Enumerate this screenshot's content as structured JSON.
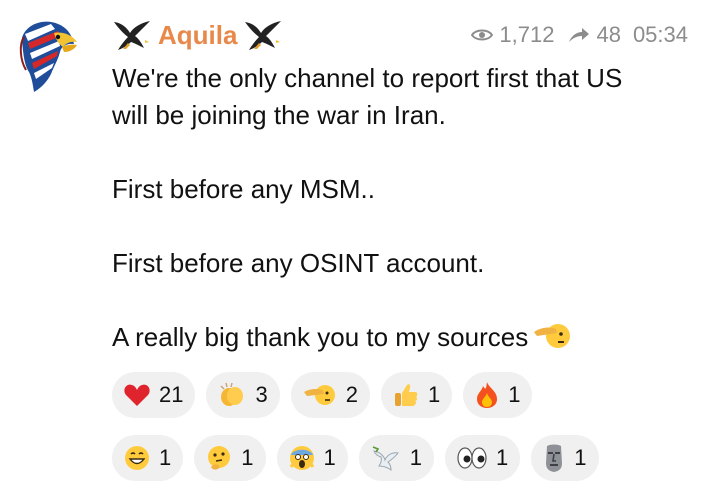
{
  "channel": {
    "name": "Aquila",
    "icon_left": "eagle-icon",
    "icon_right": "eagle-icon",
    "avatar_icon": "american-eagle-avatar-icon",
    "name_color": "#e8894b"
  },
  "meta": {
    "views_icon": "eye-icon",
    "views": "1,712",
    "forwards_icon": "forward-arrow-icon",
    "forwards": "48",
    "time": "05:34"
  },
  "message": {
    "line_1": "We're the only channel to report first that US",
    "line_2": "will be joining the war in Iran.",
    "line_3": "First before any MSM..",
    "line_4": "First before any OSINT account.",
    "line_5": "A really big thank you to my sources",
    "line_5_emoji": "saluting-face-icon"
  },
  "reactions": [
    {
      "icon": "red-heart-icon",
      "count": "21"
    },
    {
      "icon": "clapping-hands-icon",
      "count": "3"
    },
    {
      "icon": "saluting-face-icon",
      "count": "2"
    },
    {
      "icon": "thumbs-up-icon",
      "count": "1"
    },
    {
      "icon": "fire-icon",
      "count": "1"
    },
    {
      "icon": "grinning-face-icon",
      "count": "1"
    },
    {
      "icon": "thinking-face-icon",
      "count": "1"
    },
    {
      "icon": "screaming-face-icon",
      "count": "1"
    },
    {
      "icon": "dove-icon",
      "count": "1"
    },
    {
      "icon": "eyes-icon",
      "count": "1"
    },
    {
      "icon": "moai-icon",
      "count": "1"
    }
  ],
  "colors": {
    "background": "#ffffff",
    "pill_background": "#f0f0f0",
    "meta_text": "#8c8c8c",
    "text": "#111111"
  }
}
